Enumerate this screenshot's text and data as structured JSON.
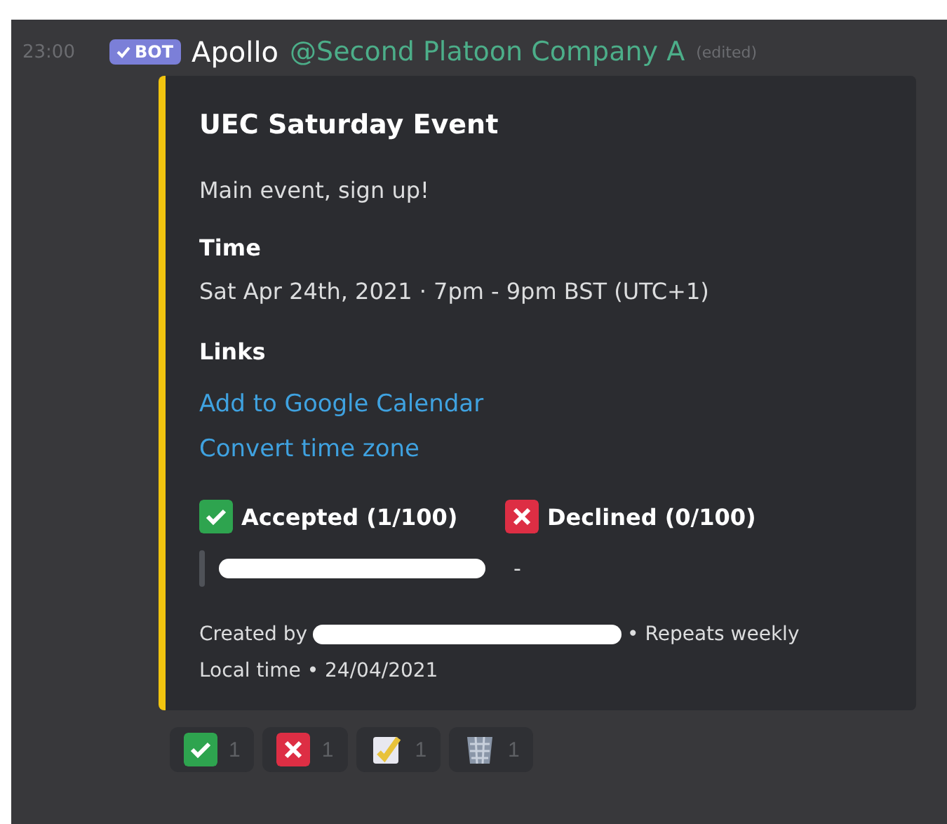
{
  "message": {
    "timestamp": "23:00",
    "badge": "BOT",
    "author": "Apollo",
    "mention": "@Second Platoon Company A",
    "edited": "(edited)"
  },
  "embed": {
    "title": "UEC Saturday Event",
    "description": "Main event, sign up!",
    "fields": [
      {
        "name": "Time",
        "value": "Sat Apr 24th, 2021 · 7pm - 9pm BST (UTC+1)"
      }
    ],
    "links_heading": "Links",
    "links": [
      "Add to Google Calendar",
      "Convert time zone"
    ],
    "responses": [
      {
        "kind": "accepted",
        "label": "Accepted (1/100)"
      },
      {
        "kind": "declined",
        "label": "Declined (0/100)",
        "placeholder": "-"
      }
    ],
    "footer": {
      "created_by": "Created by",
      "repeats": "• Repeats weekly",
      "local_time": "Local time • 24/04/2021"
    }
  },
  "reactions": [
    {
      "kind": "check",
      "count": "1"
    },
    {
      "kind": "cross",
      "count": "1"
    },
    {
      "kind": "notepad",
      "count": "1"
    },
    {
      "kind": "bin",
      "count": "1"
    }
  ]
}
